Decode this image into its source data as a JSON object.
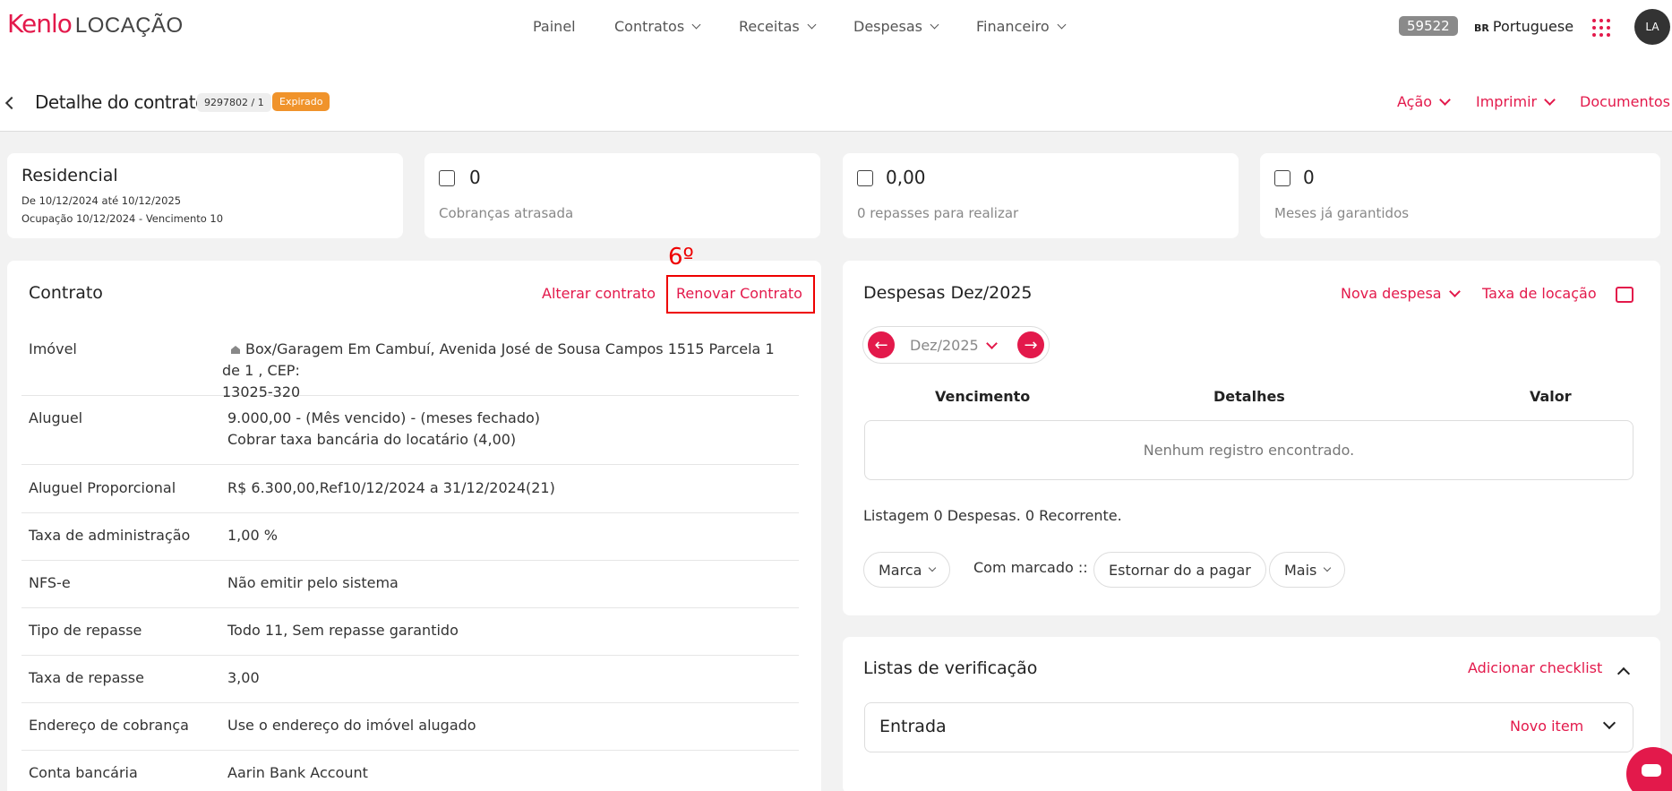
{
  "brand": {
    "name": "Kenlo",
    "product": "LOCAÇÃO",
    "accent": "#e3194b"
  },
  "nav": {
    "painel": "Painel",
    "contratos": "Contratos",
    "receitas": "Receitas",
    "despesas": "Despesas",
    "financeiro": "Financeiro"
  },
  "topbar": {
    "badge": "59522",
    "lang_code": "BR",
    "lang": "Portuguese",
    "avatar": "LA"
  },
  "header": {
    "title": "Detalhe do contrato",
    "contract_id": "9297802 / 1",
    "status": "Expirado",
    "acao": "Ação",
    "imprimir": "Imprimir",
    "documentos": "Documentos"
  },
  "summary": {
    "residencial": {
      "title": "Residencial",
      "period": "De 10/12/2024 até 10/12/2025",
      "occupation": "Ocupação 10/12/2024 - Vencimento 10"
    },
    "cobrancas": {
      "value": "0",
      "label": "Cobranças atrasada"
    },
    "repasses": {
      "value": "0,00",
      "label": "0 repasses para realizar"
    },
    "meses": {
      "value": "0",
      "label": "Meses já garantidos"
    }
  },
  "contrato": {
    "title": "Contrato",
    "alterar": "Alterar contrato",
    "renovar": "Renovar Contrato",
    "annotation": "6º",
    "rows": [
      {
        "label": "Imóvel",
        "value": "Box/Garagem Em Cambuí, Avenida José de Sousa Campos 1515 Parcela 1 de 1 , CEP:",
        "value2": "13025-320"
      },
      {
        "label": "Aluguel",
        "value": "9.000,00 - (Mês vencido) - (meses fechado)",
        "value2": "Cobrar taxa bancária do locatário (4,00)"
      },
      {
        "label": "Aluguel Proporcional",
        "value": "R$ 6.300,00,Ref10/12/2024 a 31/12/2024(21)"
      },
      {
        "label": "Taxa de administração",
        "value": "1,00 %"
      },
      {
        "label": "NFS-e",
        "value": "Não emitir pelo sistema"
      },
      {
        "label": "Tipo de repasse",
        "value": "Todo 11, Sem repasse garantido"
      },
      {
        "label": "Taxa de repasse",
        "value": "3,00"
      },
      {
        "label": "Endereço de cobrança",
        "value": "Use o endereço do imóvel alugado"
      },
      {
        "label": "Conta bancária",
        "value": "Aarin Bank Account"
      }
    ]
  },
  "despesas": {
    "title": "Despesas Dez/2025",
    "nova": "Nova despesa",
    "taxa": "Taxa de locação",
    "month": "Dez/2025",
    "columns": [
      "Vencimento",
      "Detalhes",
      "Valor"
    ],
    "empty": "Nenhum registro encontrado.",
    "summary": "Listagem 0 Despesas. 0 Recorrente.",
    "marca": "Marca",
    "com_marcado": "Com marcado ::",
    "estornar": "Estornar do a pagar",
    "mais": "Mais"
  },
  "checklist": {
    "title": "Listas de verificação",
    "adicionar": "Adicionar checklist",
    "entrada": "Entrada",
    "novo_item": "Novo item"
  }
}
